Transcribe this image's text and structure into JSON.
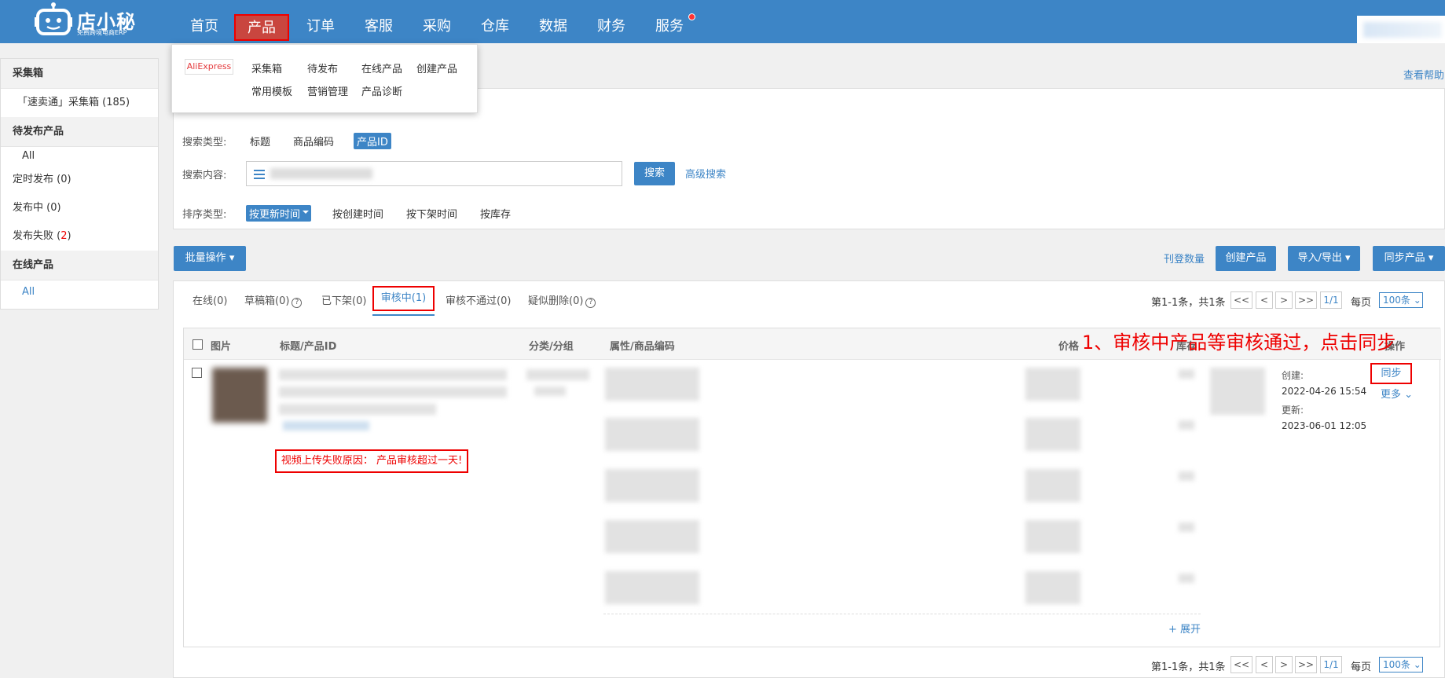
{
  "logo": {
    "brand": "店小秘",
    "tagline": "免费跨境电商ERP"
  },
  "nav": [
    "首页",
    "产品",
    "订单",
    "客服",
    "采购",
    "仓库",
    "数据",
    "财务",
    "服务"
  ],
  "nav_active": "产品",
  "dropdown": {
    "platform": "AliExpress",
    "row1": [
      "采集箱",
      "待发布",
      "在线产品",
      "创建产品"
    ],
    "row2": [
      "常用模板",
      "营销管理",
      "产品诊断"
    ]
  },
  "sidebar": {
    "collect_head": "采集箱",
    "collect_item": "「速卖通」采集箱 (185)",
    "pending_head": "待发布产品",
    "pending_all": "All",
    "scheduled": "定时发布 (0)",
    "publishing": "发布中 (0)",
    "failed_label": "发布失败 (",
    "failed_count": "2",
    "failed_close": ")",
    "online_head": "在线产品",
    "online_all": "All"
  },
  "help": "查看帮助",
  "search": {
    "type_label": "搜索类型:",
    "types": [
      "标题",
      "商品编码",
      "产品ID"
    ],
    "content_label": "搜索内容:",
    "search_btn": "搜索",
    "advanced": "高级搜索",
    "sort_label": "排序类型:",
    "sorts": [
      "按更新时间",
      "按创建时间",
      "按下架时间",
      "按库存"
    ]
  },
  "actions": {
    "batch": "批量操作",
    "listing_count": "刊登数量",
    "create": "创建产品",
    "import_export": "导入/导出",
    "sync_products": "同步产品"
  },
  "tabs": {
    "online": "在线(0)",
    "draft": "草稿箱(0)",
    "offline": "已下架(0)",
    "reviewing": "审核中(1)",
    "rejected": "审核不通过(0)",
    "suspect_deleted": "疑似删除(0)"
  },
  "pager": {
    "count": "第1-1条，共1条",
    "first": "<<",
    "prev": "<",
    "next": ">",
    "last": ">>",
    "page": "1/1",
    "per_page_label": "每页",
    "per_page": "100条"
  },
  "table": {
    "headers": [
      "图片",
      "标题/产品ID",
      "分类/分组",
      "属性/商品编码",
      "价格",
      "库存",
      "操作"
    ],
    "error": "视频上传失败原因：   产品审核超过一天!",
    "created_label": "创建:",
    "created": "2022-04-26 15:54",
    "updated_label": "更新:",
    "updated": "2023-06-01 12:05",
    "sync": "同步",
    "more": "更多",
    "expand": "+ 展开"
  },
  "annotation": "1、审核中产品等审核通过，点击同步"
}
